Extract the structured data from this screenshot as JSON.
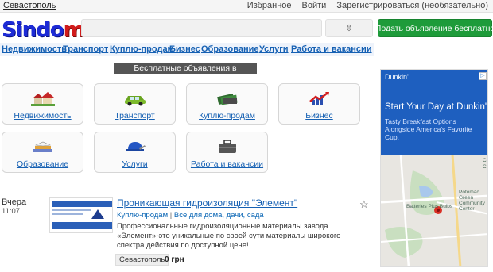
{
  "topbar": {
    "city": "Севастополь",
    "favorites": "Избранное",
    "login": "Войти",
    "register": "Зарегистрироваться (необязательно)"
  },
  "header": {
    "logo_main": "Sindo",
    "logo_accent": "m",
    "search_value": "",
    "select_icon": "⇳",
    "post_button": "Подать объявление бесплатно"
  },
  "nav": {
    "items": [
      "Недвижимость",
      "Транспорт",
      "Куплю-продам",
      "Бизнес",
      "Образование",
      "Услуги",
      "Работа и вакансии"
    ]
  },
  "heading": "Бесплатные объявления в Севастополе",
  "tiles": [
    {
      "label": "Недвижимость",
      "icon": "houses-icon"
    },
    {
      "label": "Транспорт",
      "icon": "car-icon"
    },
    {
      "label": "Куплю-продам",
      "icon": "money-icon"
    },
    {
      "label": "Бизнес",
      "icon": "chart-arrow-icon"
    },
    {
      "label": "Образование",
      "icon": "books-icon"
    },
    {
      "label": "Услуги",
      "icon": "worker-helmet-icon"
    },
    {
      "label": "Работа и вакансии",
      "icon": "briefcase-icon"
    }
  ],
  "listing": {
    "date": "Вчера",
    "time": "11:07",
    "title": "Проникающая гидроизоляция \"Элемент\"",
    "category": "Куплю-продам",
    "subcategory": "Все для дома, дачи, сада",
    "description": "Профессиональные гидроизоляционные материалы завода «Элемент»-это уникальные по своей сути материалы широкого спектра действия по доступной цене! ...",
    "city": "Севастополь",
    "price": "0 грн"
  },
  "advert": {
    "brand": "Dunkin'",
    "corner": "▷",
    "headline": "Start Your Day at Dunkin'",
    "subtext": "Tasty Breakfast Options Alongside America's Favorite Cup.",
    "map_labels": [
      "Potomac Green Community Center",
      "Batteries Plus Bulbs",
      "Ce",
      "Ch"
    ]
  },
  "colors": {
    "brand_blue": "#1d2bd6",
    "brand_red": "#d11b1b",
    "post_green": "#1e9b3a",
    "link_blue": "#1560b3",
    "ad_blue": "#1e5fbf"
  }
}
